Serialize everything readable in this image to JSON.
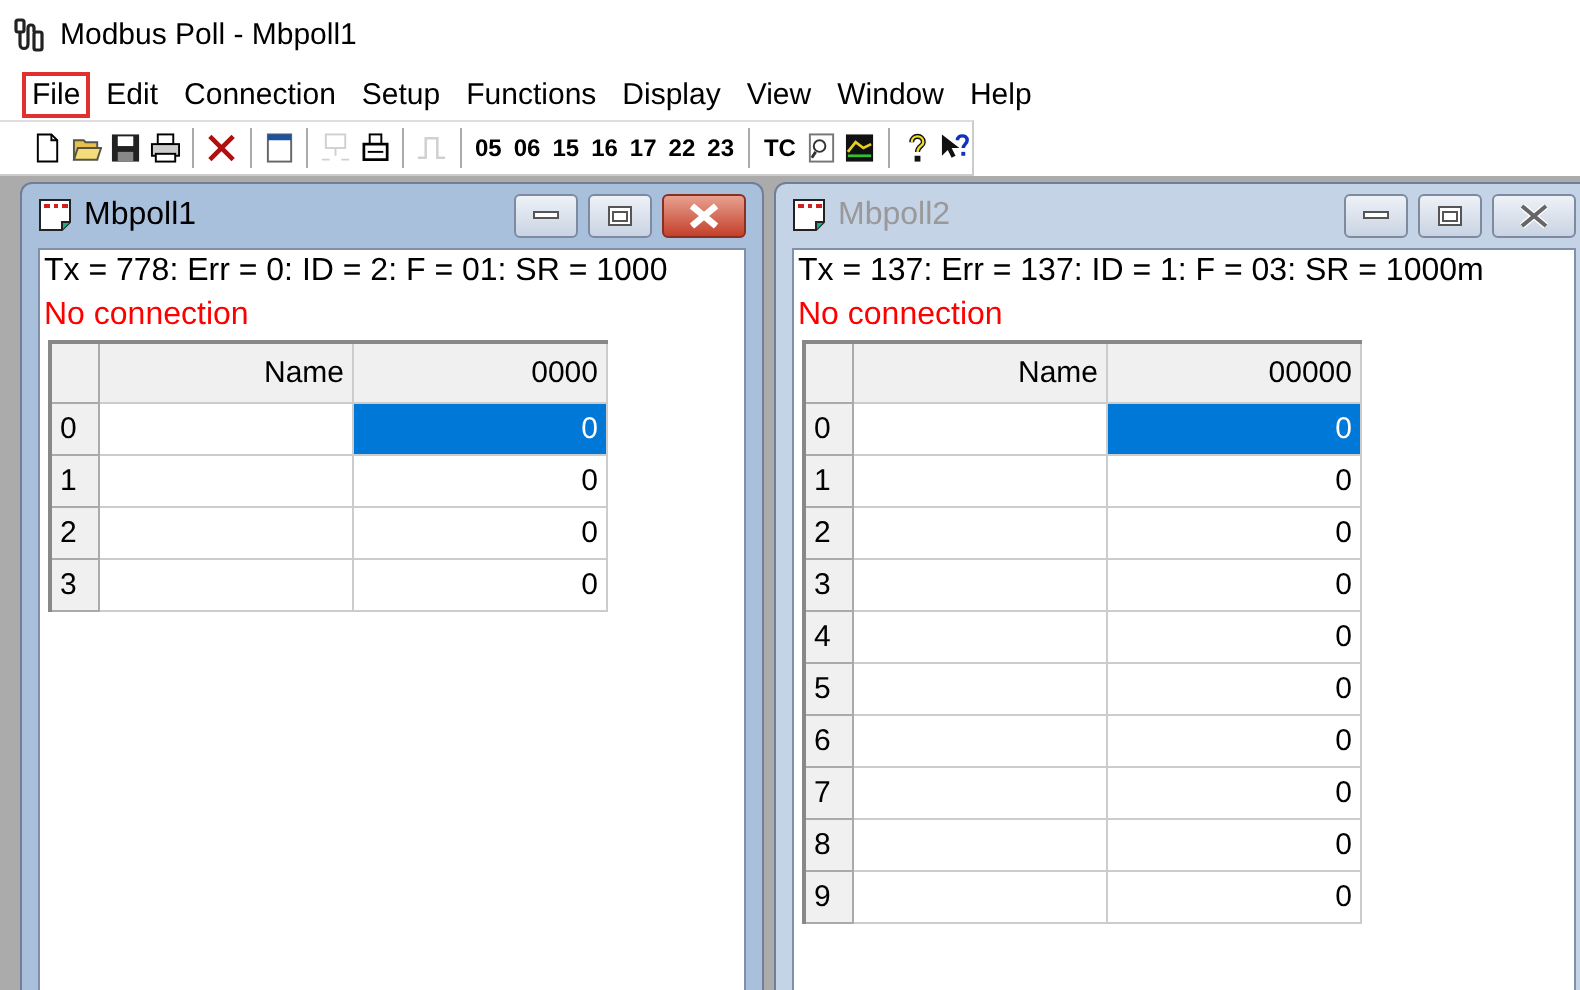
{
  "app": {
    "title": "Modbus Poll - Mbpoll1"
  },
  "menu": [
    {
      "label": "File",
      "selected": true
    },
    {
      "label": "Edit",
      "selected": false
    },
    {
      "label": "Connection",
      "selected": false
    },
    {
      "label": "Setup",
      "selected": false
    },
    {
      "label": "Functions",
      "selected": false
    },
    {
      "label": "Display",
      "selected": false
    },
    {
      "label": "View",
      "selected": false
    },
    {
      "label": "Window",
      "selected": false
    },
    {
      "label": "Help",
      "selected": false
    }
  ],
  "toolbar": [
    {
      "kind": "icon",
      "disabled": false
    },
    {
      "kind": "icon",
      "disabled": false
    },
    {
      "kind": "icon",
      "disabled": false
    },
    {
      "kind": "icon",
      "disabled": false
    },
    {
      "kind": "separator"
    },
    {
      "kind": "icon",
      "disabled": false
    },
    {
      "kind": "separator"
    },
    {
      "kind": "icon",
      "disabled": false
    },
    {
      "kind": "separator"
    },
    {
      "kind": "icon",
      "disabled": true
    },
    {
      "kind": "icon",
      "disabled": false
    },
    {
      "kind": "separator"
    },
    {
      "kind": "icon",
      "disabled": true
    },
    {
      "kind": "separator"
    },
    {
      "kind": "text",
      "label": "05"
    },
    {
      "kind": "text",
      "label": "06"
    },
    {
      "kind": "text",
      "label": "15"
    },
    {
      "kind": "text",
      "label": "16"
    },
    {
      "kind": "text",
      "label": "17"
    },
    {
      "kind": "text",
      "label": "22"
    },
    {
      "kind": "text",
      "label": "23"
    },
    {
      "kind": "separator"
    },
    {
      "kind": "text",
      "label": "TC"
    },
    {
      "kind": "icon",
      "disabled": false
    },
    {
      "kind": "icon",
      "disabled": false
    },
    {
      "kind": "separator"
    },
    {
      "kind": "icon",
      "disabled": false
    },
    {
      "kind": "icon",
      "disabled": false
    }
  ],
  "windows": [
    {
      "title": "Mbpoll1",
      "active": true,
      "status": "Tx = 778: Err = 0: ID = 2: F = 01: SR = 1000",
      "connection": "No connection",
      "columns": [
        "Name",
        "0000"
      ],
      "rows": [
        {
          "num": "0",
          "value": "0",
          "selected": true
        },
        {
          "num": "1",
          "value": "0",
          "selected": false
        },
        {
          "num": "2",
          "value": "0",
          "selected": false
        },
        {
          "num": "3",
          "value": "0",
          "selected": false
        }
      ]
    },
    {
      "title": "Mbpoll2",
      "active": false,
      "status": "Tx = 137: Err = 137: ID = 1: F = 03: SR = 1000m",
      "connection": "No connection",
      "columns": [
        "Name",
        "00000"
      ],
      "rows": [
        {
          "num": "0",
          "value": "0",
          "selected": true
        },
        {
          "num": "1",
          "value": "0",
          "selected": false
        },
        {
          "num": "2",
          "value": "0",
          "selected": false
        },
        {
          "num": "3",
          "value": "0",
          "selected": false
        },
        {
          "num": "4",
          "value": "0",
          "selected": false
        },
        {
          "num": "5",
          "value": "0",
          "selected": false
        },
        {
          "num": "6",
          "value": "0",
          "selected": false
        },
        {
          "num": "7",
          "value": "0",
          "selected": false
        },
        {
          "num": "8",
          "value": "0",
          "selected": false
        },
        {
          "num": "9",
          "value": "0",
          "selected": false
        }
      ]
    }
  ]
}
